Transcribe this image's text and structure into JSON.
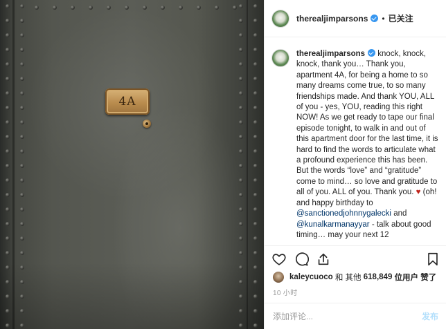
{
  "photo": {
    "plate_text": "4A"
  },
  "header": {
    "username": "therealjimparsons",
    "separator": "•",
    "follow_label": "已关注"
  },
  "caption": {
    "username": "therealjimparsons",
    "body_1": "knock, knock, knock, thank you… Thank you, apartment 4A, for being a home to so many dreams come true, to so many friendships made. And thank YOU, ALL of you - yes, YOU, reading this right NOW! As we get ready to tape our final episode tonight, to walk in and out of this apartment door for the last time, it is hard to find the words to articulate what a profound experience this has been. But the words “love” and “gratitude” come to mind… so love and gratitude to all of you. ALL of you. Thank you.",
    "heart": "♥",
    "body_2": "(oh! and happy birthday to",
    "mention_1": "@sanctionedjohnnygalecki",
    "and_text": "and",
    "mention_2": "@kunalkarmanayyar",
    "body_3": "- talk about good timing… may your next 12"
  },
  "actions": {
    "like_icon": "heart-outline-icon",
    "comment_icon": "comment-bubble-icon",
    "share_icon": "share-arrow-icon",
    "save_icon": "bookmark-icon"
  },
  "likes": {
    "liker": "kaleycuoco",
    "connector": "和 其他",
    "count": "618,849",
    "suffix": "位用户 赞了"
  },
  "timestamp": "10 小时",
  "comment_box": {
    "placeholder": "添加评论...",
    "post_label": "发布"
  }
}
